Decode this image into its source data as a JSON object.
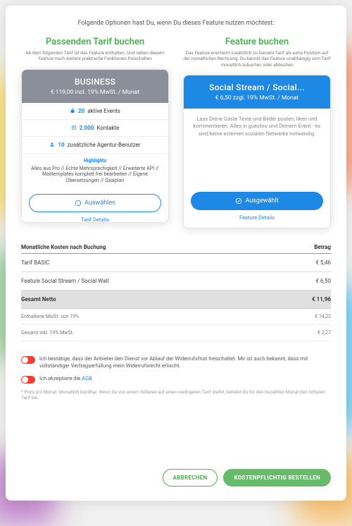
{
  "intro": "Folgende Optionen hast Du, wenn Du dieses Feature nutzen möchtest:",
  "left": {
    "title": "Passenden Tarif buchen",
    "sub": "Ab dem folgenden Tarif ist das Feature enthalten.\nUnd neben diesem Feature noch weitere praktische Funktionen freischalten",
    "card": {
      "name": "BUSINESS",
      "price": "€ 119,00 incl. 19% MwSt. / Monat",
      "f1v": "20",
      "f1t": "aktive Events",
      "f2v": "2.000",
      "f2t": "Kontakte",
      "f3v": "10",
      "f3t": "zusätzliche Agentur-Benutzer",
      "hl_title": "Highlights",
      "hl": "Alles aus Pro // Echte Mehrsprachigkeit // Erweiterte API // Mailtemplates komplett frei bearbeiten // Eigene Übersetzungen // Saalplan",
      "btn": "Auswählen",
      "detail": "Tarif Details"
    }
  },
  "right": {
    "title": "Feature buchen",
    "sub": "Das Feature erscheint zusätzlich zu Deinem Tarif als extra Position auf der monatlichen Rechnung. Du kannst das Feature unabhängig vom Tarif monatlich zubuchen oder abbuchen",
    "card": {
      "name": "Social Stream / Social...",
      "price": "€ 6,50 zzgl. 19% MwSt. / Monat",
      "desc": "Lass Deine Gäste Texte und Bilder posten, liken und kommentieren. Alles in guestoo und Deinem Event - es sind keine externen sozialen Netwerke notwendig.",
      "btn": "Ausgewählt",
      "detail": "Feature Details"
    }
  },
  "cost": {
    "h1": "Monatliche Kosten nach Buchung",
    "h2": "Betrag",
    "r1l": "Tarif BASIC",
    "r1v": "€ 5,46",
    "r2l": "Feature Social Stream / Social Wall",
    "r2v": "€ 6,50",
    "tl": "Gesamt Netto",
    "tv": "€ 11,96",
    "s1l": "Enthaltene MwSt. von 19%",
    "s1v": "€ 14,23",
    "s2l": "Gesamt inkl. 19% MwSt.",
    "s2v": "€ 2,27"
  },
  "checks": {
    "c1": "Ich bestätige, dass der Anbieter den Dienst vor Ablauf der Widerrufsfrist freischaltet. Mir ist auch bekannt, dass mit vollständiger Vertragserfüllung mein Widerrufsrecht erlischt.",
    "c2a": "Ich akzeptiere die ",
    "c2b": "AGB",
    "note": "* Preis pro Monat. Monatlich kündbar. Wenn Du von einem höheren auf einen niedrigeren Tarif stellst, behälst Du für den bezahlten Monat den höheren Tarif bei."
  },
  "actions": {
    "cancel": "ABBRECHEN",
    "order": "KOSTENPFLICHTIG BESTELLEN"
  }
}
